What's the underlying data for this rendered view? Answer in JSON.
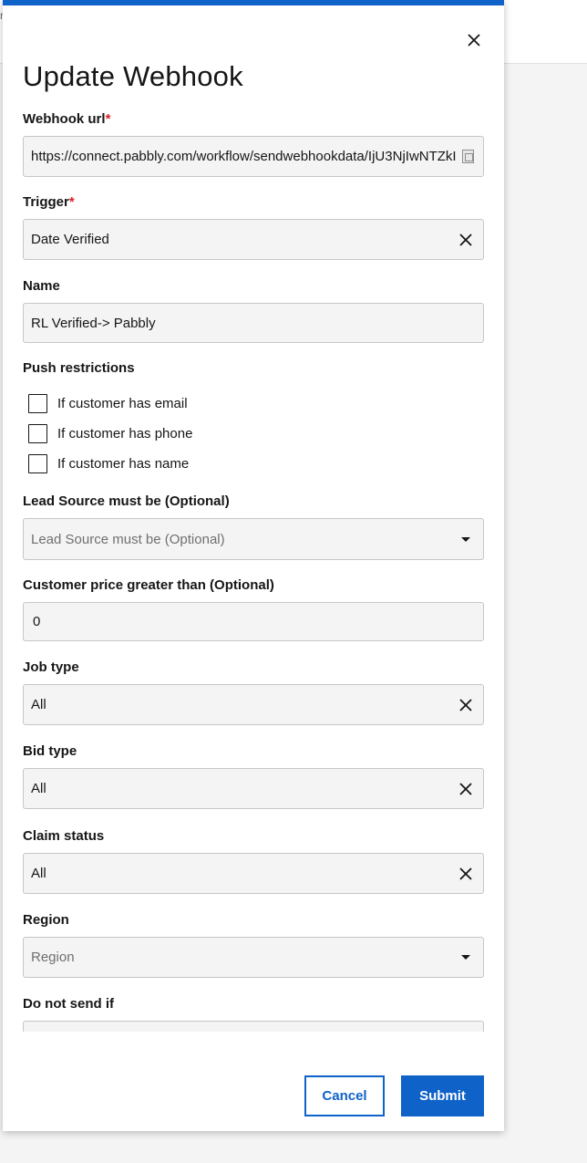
{
  "background": {
    "partial_char": "r"
  },
  "modal": {
    "title": "Update Webhook",
    "fields": {
      "webhook_url": {
        "label": "Webhook url",
        "required_mark": "*",
        "value": "https://connect.pabbly.com/workflow/sendwebhookdata/IjU3NjIwNTZkI"
      },
      "trigger": {
        "label": "Trigger",
        "required_mark": "*",
        "value": "Date Verified"
      },
      "name": {
        "label": "Name",
        "value": "RL Verified-> Pabbly"
      },
      "push_restrictions": {
        "label": "Push restrictions",
        "options": [
          {
            "label": "If customer has email",
            "checked": false
          },
          {
            "label": "If customer has phone",
            "checked": false
          },
          {
            "label": "If customer has name",
            "checked": false
          }
        ]
      },
      "lead_source": {
        "label": "Lead Source must be (Optional)",
        "placeholder": "Lead Source must be (Optional)"
      },
      "customer_price": {
        "label": "Customer price greater than (Optional)",
        "value": "0"
      },
      "job_type": {
        "label": "Job type",
        "value": "All"
      },
      "bid_type": {
        "label": "Bid type",
        "value": "All"
      },
      "claim_status": {
        "label": "Claim status",
        "value": "All"
      },
      "region": {
        "label": "Region",
        "placeholder": "Region"
      },
      "do_not_send_if": {
        "label": "Do not send if"
      }
    },
    "buttons": {
      "cancel": "Cancel",
      "submit": "Submit"
    }
  },
  "colors": {
    "accent": "#0f62c8",
    "required": "#da1e28",
    "input_bg": "#f4f4f4",
    "text": "#161616"
  },
  "icons": {
    "close": "close-icon",
    "clear": "clear-icon",
    "dropdown": "chevron-down-icon"
  }
}
